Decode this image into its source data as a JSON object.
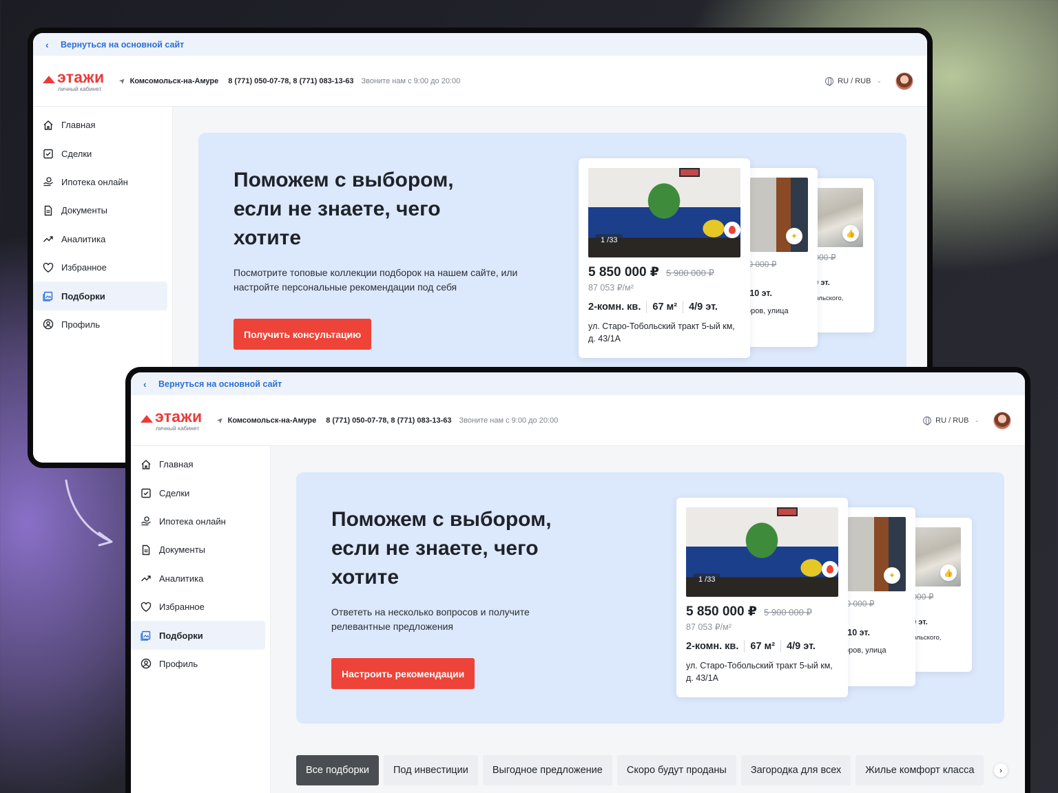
{
  "backbar": {
    "label": "Вернуться на основной сайт"
  },
  "header": {
    "logo_text": "этажи",
    "logo_sub": "личный кабинет",
    "city": "Комсомольск-на-Амуре",
    "phones": "8 (771) 050-07-78, 8 (771) 083-13-63",
    "hours": "Звоните нам с 9:00 до 20:00",
    "lang": "RU / RUB"
  },
  "nav": [
    {
      "label": "Главная",
      "icon": "home-icon"
    },
    {
      "label": "Сделки",
      "icon": "checklist-icon"
    },
    {
      "label": "Ипотека онлайн",
      "icon": "hand-coins-icon"
    },
    {
      "label": "Документы",
      "icon": "document-icon"
    },
    {
      "label": "Аналитика",
      "icon": "trend-icon"
    },
    {
      "label": "Избранное",
      "icon": "heart-icon"
    },
    {
      "label": "Подборки",
      "icon": "gallery-icon",
      "active": true
    },
    {
      "label": "Профиль",
      "icon": "user-circle-icon"
    }
  ],
  "screen1": {
    "hero": {
      "title": "Поможем с выбором, если не знаете, чего хотите",
      "text": "Посмотрите топовые коллекции подборок на нашем сайте, или настройте персональные рекомендации под себя",
      "cta": "Получить консультацию"
    }
  },
  "screen2": {
    "hero": {
      "title": "Поможем с выбором, если не знаете, чего хотите",
      "text": "Ответеть на несколько вопросов и получите релевантные предложения",
      "cta": "Настроить рекомендации"
    },
    "tabs": [
      "Все подборки",
      "Под инвестиции",
      "Выгодное предложение",
      "Скоро будут проданы",
      "Загородка для всех",
      "Жилье комфорт класса"
    ],
    "active_tab": 0
  },
  "cards": {
    "main": {
      "photo_count": "1 /33",
      "price": "5 850 000 ₽",
      "old_price": "5 900 000 ₽",
      "price_per_m": "87 053 ₽/м²",
      "rooms": "2-комн. кв.",
      "area": "67 м²",
      "floor": "4/9 эт.",
      "address": "ул. Старо-Тобольский тракт 5-ый км, д. 43/1А"
    },
    "second": {
      "old_price": "7 100 000 ₽",
      "specs": "м²  8/10 эт.",
      "address_line1": "ораторов, улица",
      "address_line2": ".2"
    },
    "third": {
      "old_price": "000 000 ₽",
      "specs": "2/9 эт.",
      "address": "а Никольского,"
    }
  },
  "colors": {
    "accent": "#ee4338",
    "link": "#2b6fd6",
    "hero_bg": "#dce8fb"
  }
}
